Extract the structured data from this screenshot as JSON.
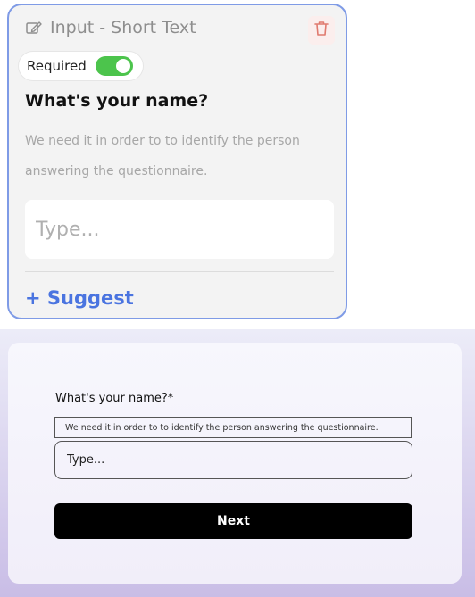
{
  "editor": {
    "field_type": "Input - Short Text",
    "field_icon": "edit-icon",
    "delete_icon": "trash-icon",
    "required_label": "Required",
    "required_on": true,
    "question": "What's your name?",
    "description": "We need it in order to to identify the person answering the questionnaire.",
    "input_placeholder": "Type...",
    "suggest_label": "+ Suggest"
  },
  "preview": {
    "question": "What's your name?*",
    "description": "We need it in order to to identify the person answering the questionnaire.",
    "input_placeholder": "Type...",
    "next_label": "Next"
  },
  "colors": {
    "card_border": "#7f9be6",
    "toggle_on": "#4cc44c",
    "suggest": "#4a74e0",
    "delete_icon": "#e07a6f",
    "next_button": "#000000"
  }
}
